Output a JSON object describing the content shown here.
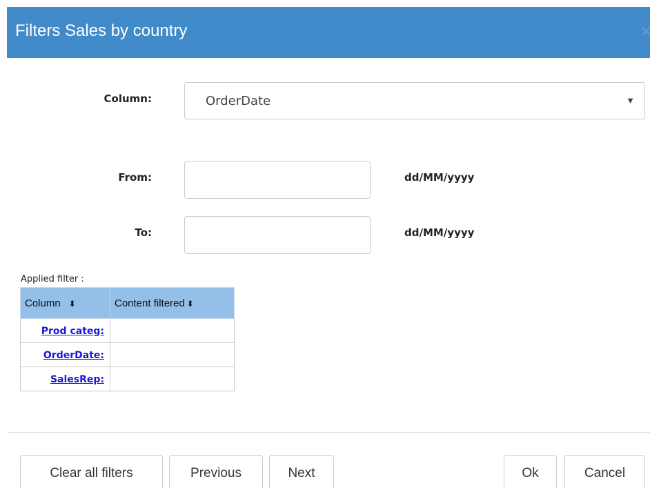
{
  "dialog": {
    "title": "Filters Sales by country",
    "close_symbol": "×"
  },
  "form": {
    "column_label": "Column:",
    "column_value": "OrderDate",
    "caret": "▼",
    "from_label": "From:",
    "from_value": "",
    "from_format": "dd/MM/yyyy",
    "to_label": "To:",
    "to_value": "",
    "to_format": "dd/MM/yyyy"
  },
  "applied": {
    "caption": "Applied filter :",
    "headers": [
      "Column",
      "Content filtered"
    ],
    "sort_icon": "⬍",
    "rows": [
      {
        "column": "Prod categ:",
        "content": ""
      },
      {
        "column": "OrderDate:",
        "content": ""
      },
      {
        "column": "SalesRep:",
        "content": ""
      }
    ]
  },
  "footer": {
    "clear": "Clear all filters",
    "previous": "Previous",
    "next": "Next",
    "ok": "Ok",
    "cancel": "Cancel"
  },
  "colors": {
    "titlebar": "#428bca",
    "header_row": "#93bfe8",
    "link": "#1919d6"
  }
}
